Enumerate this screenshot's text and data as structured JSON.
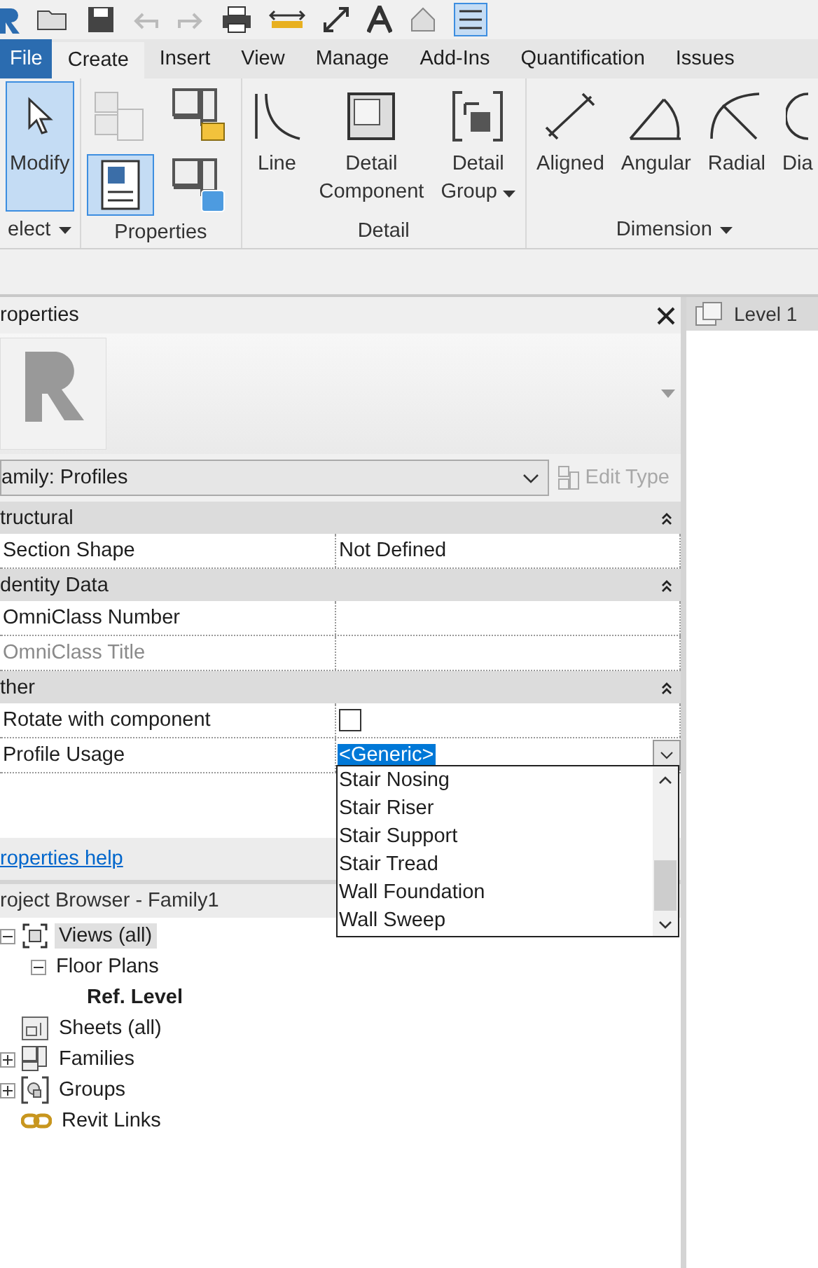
{
  "ribbon_tabs": [
    {
      "label": "File",
      "kind": "file",
      "selected": false
    },
    {
      "label": "Create",
      "kind": "tab",
      "selected": true
    },
    {
      "label": "Insert",
      "kind": "tab",
      "selected": false
    },
    {
      "label": "View",
      "kind": "tab",
      "selected": false
    },
    {
      "label": "Manage",
      "kind": "tab",
      "selected": false
    },
    {
      "label": "Add-Ins",
      "kind": "tab",
      "selected": false
    },
    {
      "label": "Quantification",
      "kind": "tab",
      "selected": false
    },
    {
      "label": "Issues",
      "kind": "tab",
      "selected": false
    }
  ],
  "ribbon_panels": [
    {
      "label": "elect",
      "has_menu": true,
      "tools": [
        {
          "label": "Modify",
          "selected": true
        }
      ]
    },
    {
      "label": "Properties",
      "has_menu": false,
      "tools": [
        {
          "selected": false
        },
        {
          "selected": false
        },
        {
          "selected": true
        },
        {
          "selected": false
        }
      ]
    },
    {
      "label": "Detail",
      "has_menu": false,
      "tools": [
        {
          "label": "Line",
          "selected": false,
          "has_menu": false
        },
        {
          "label": "Detail Component",
          "selected": false,
          "has_menu": false
        },
        {
          "label": "Detail Group",
          "selected": false,
          "has_menu": true
        }
      ]
    },
    {
      "label": "Dimension",
      "has_menu": true,
      "tools": [
        {
          "label": "Aligned",
          "selected": false
        },
        {
          "label": "Angular",
          "selected": false
        },
        {
          "label": "Radial",
          "selected": false
        },
        {
          "label": "Dia",
          "selected": false
        }
      ]
    }
  ],
  "properties": {
    "title": "roperties",
    "family_selector": "amily: Profiles",
    "edit_type": {
      "label": "Edit Type",
      "disabled": true
    },
    "rows": [
      {
        "kind": "section",
        "label": "tructural"
      },
      {
        "kind": "param",
        "label": "Section Shape",
        "value": "Not Defined",
        "disabled": false
      },
      {
        "kind": "section",
        "label": "dentity Data"
      },
      {
        "kind": "param",
        "label": "OmniClass Number",
        "value": "",
        "disabled": false
      },
      {
        "kind": "param",
        "label": "OmniClass Title",
        "value": "",
        "disabled": true
      },
      {
        "kind": "section",
        "label": "ther"
      },
      {
        "kind": "checkbox",
        "label": "Rotate with component",
        "checked": false,
        "disabled": false
      },
      {
        "kind": "dropdown",
        "label": "Profile Usage",
        "value": "<Generic>",
        "disabled": false
      }
    ],
    "dropdown_options": [
      "Stair Nosing",
      "Stair Riser",
      "Stair Support",
      "Stair Tread",
      "Wall Foundation",
      "Wall Sweep"
    ],
    "help_link": "roperties help"
  },
  "project_browser": {
    "title": "roject Browser - Family1",
    "tree": [
      {
        "label": "Views (all)",
        "kind": "views",
        "selected": true,
        "bold": false,
        "expanded": true,
        "children": [
          {
            "label": "Floor Plans",
            "selected": false,
            "bold": false,
            "expanded": true,
            "children": [
              {
                "label": "Ref. Level",
                "selected": false,
                "bold": true
              }
            ]
          }
        ]
      },
      {
        "label": "Sheets (all)",
        "kind": "sheets",
        "selected": false,
        "bold": false
      },
      {
        "label": "Families",
        "kind": "families",
        "selected": false,
        "bold": false,
        "expanded": false
      },
      {
        "label": "Groups",
        "kind": "groups",
        "selected": false,
        "bold": false,
        "expanded": false
      },
      {
        "label": "Revit Links",
        "kind": "links",
        "selected": false,
        "bold": false
      }
    ]
  },
  "view_tab": {
    "label": "Level 1"
  }
}
